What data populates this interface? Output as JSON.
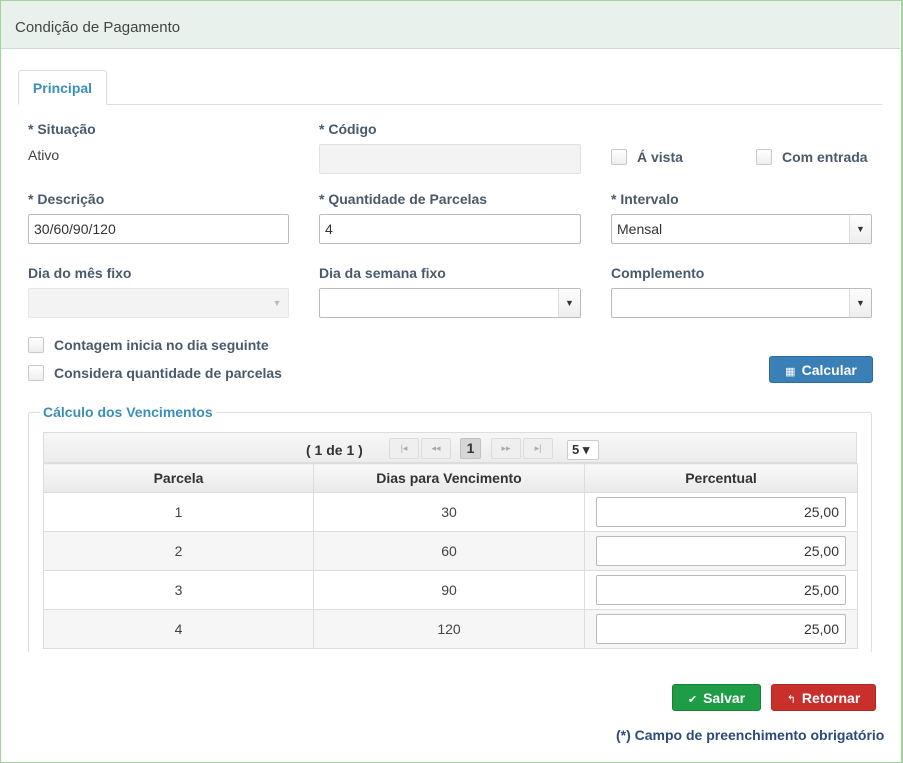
{
  "window": {
    "title": "Condição de Pagamento"
  },
  "tabs": [
    {
      "label": "Principal"
    }
  ],
  "fields": {
    "situacao": {
      "label": "* Situação",
      "value": "Ativo"
    },
    "codigo": {
      "label": "* Código",
      "value": ""
    },
    "a_vista": {
      "label": "Á vista",
      "checked": false
    },
    "com_entrada": {
      "label": "Com entrada",
      "checked": false
    },
    "descricao": {
      "label": "* Descrição",
      "value": "30/60/90/120"
    },
    "quantidade_parcelas": {
      "label": "* Quantidade de Parcelas",
      "value": "4"
    },
    "intervalo": {
      "label": "* Intervalo",
      "value": "Mensal"
    },
    "dia_mes_fixo": {
      "label": "Dia do mês fixo",
      "value": ""
    },
    "dia_semana_fixo": {
      "label": "Dia da semana fixo",
      "value": ""
    },
    "complemento": {
      "label": "Complemento",
      "value": ""
    },
    "contagem_dia_seguinte": {
      "label": "Contagem inicia no dia seguinte",
      "checked": false
    },
    "considera_qtd_parcelas": {
      "label": "Considera quantidade de parcelas",
      "checked": false
    }
  },
  "calcular_button": {
    "label": "Calcular",
    "icon": "calculator-icon"
  },
  "vencimentos": {
    "legend": "Cálculo dos Vencimentos",
    "paginator": {
      "current": "( 1 de 1 )",
      "first": "|◂",
      "prev": "◂◂",
      "page": "1",
      "next": "▸▸",
      "last": "▸|",
      "rows_per_page": "5 ▾"
    },
    "columns": [
      "Parcela",
      "Dias para Vencimento",
      "Percentual"
    ],
    "rows": [
      {
        "parcela": "1",
        "dias": "30",
        "percentual": "25,00"
      },
      {
        "parcela": "2",
        "dias": "60",
        "percentual": "25,00"
      },
      {
        "parcela": "3",
        "dias": "90",
        "percentual": "25,00"
      },
      {
        "parcela": "4",
        "dias": "120",
        "percentual": "25,00"
      }
    ]
  },
  "footer": {
    "salvar": "Salvar",
    "retornar": "Retornar",
    "note": "(*) Campo de preenchimento obrigatório"
  },
  "colors": {
    "accent": "#3a8fb7",
    "save": "#1e9d46",
    "cancel": "#c9302c",
    "calc": "#3a7fb5"
  }
}
